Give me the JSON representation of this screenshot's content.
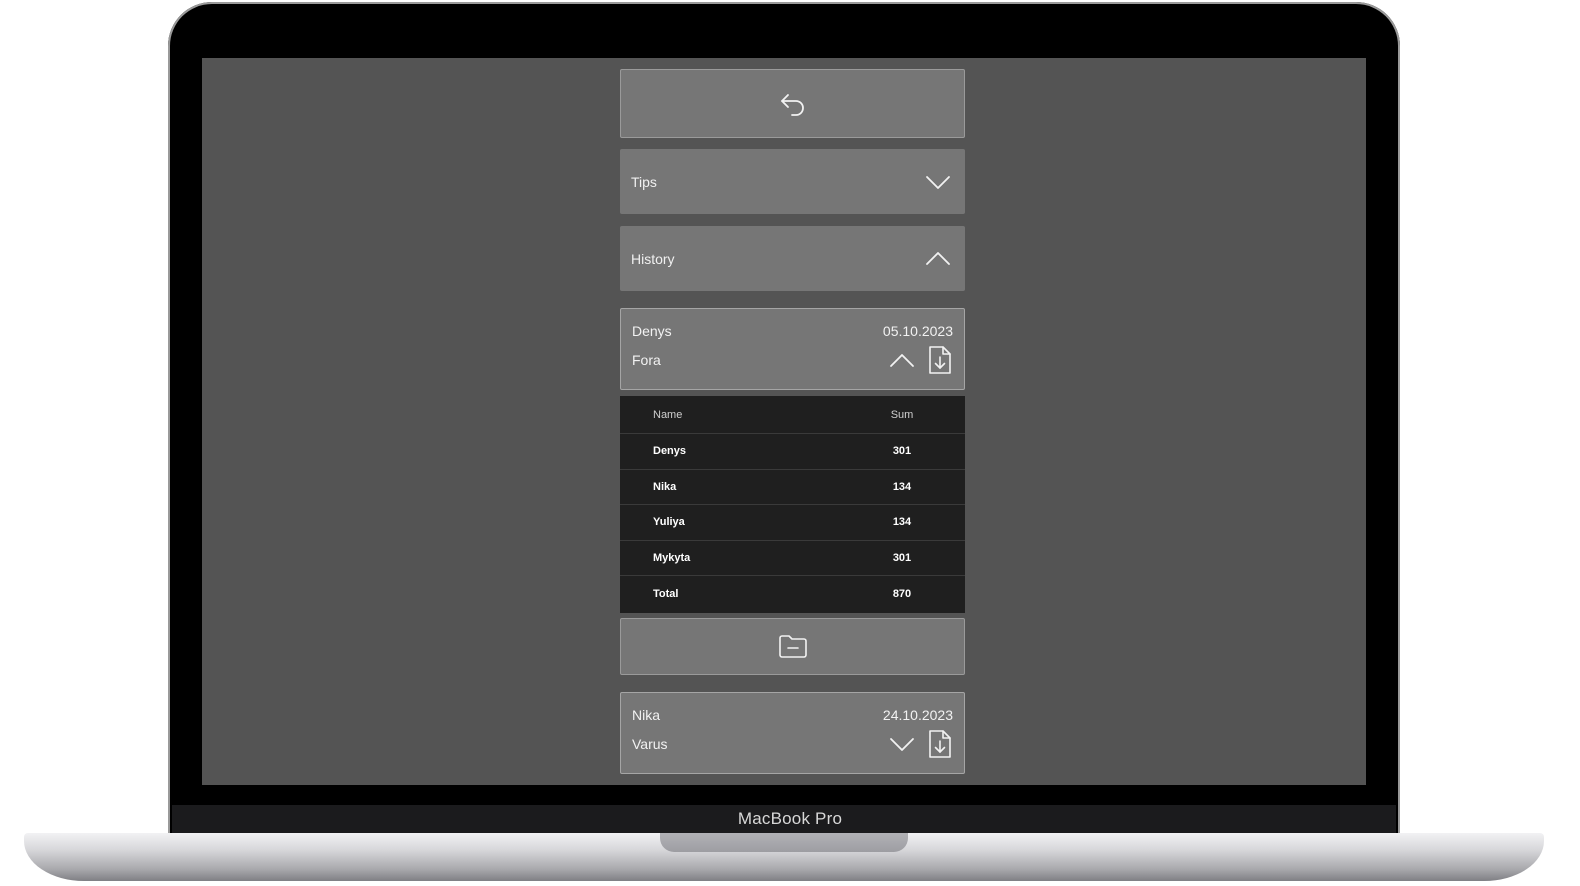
{
  "device": {
    "brand_label": "MacBook Pro"
  },
  "toolbar": {
    "back_icon": "undo-arrow-icon"
  },
  "sections": {
    "tips": {
      "label": "Tips",
      "state": "collapsed",
      "icon": "chevron-down-icon"
    },
    "history": {
      "label": "History",
      "state": "expanded",
      "icon": "chevron-up-icon"
    }
  },
  "history_entries": [
    {
      "name": "Denys",
      "date": "05.10.2023",
      "store": "Fora",
      "state": "expanded",
      "table": {
        "headers": {
          "name": "Name",
          "sum": "Sum"
        },
        "rows": [
          {
            "name": "Denys",
            "sum": "301"
          },
          {
            "name": "Nika",
            "sum": "134"
          },
          {
            "name": "Yuliya",
            "sum": "134"
          },
          {
            "name": "Mykyta",
            "sum": "301"
          }
        ],
        "total": {
          "label": "Total",
          "sum": "870"
        }
      },
      "archive_icon": "folder-minus-icon"
    },
    {
      "name": "Nika",
      "date": "24.10.2023",
      "store": "Varus",
      "state": "collapsed"
    }
  ],
  "colors": {
    "screen_bg": "#545454",
    "panel_bg": "#767676",
    "table_bg": "#1f1f1f",
    "text": "#f0f0f0"
  }
}
